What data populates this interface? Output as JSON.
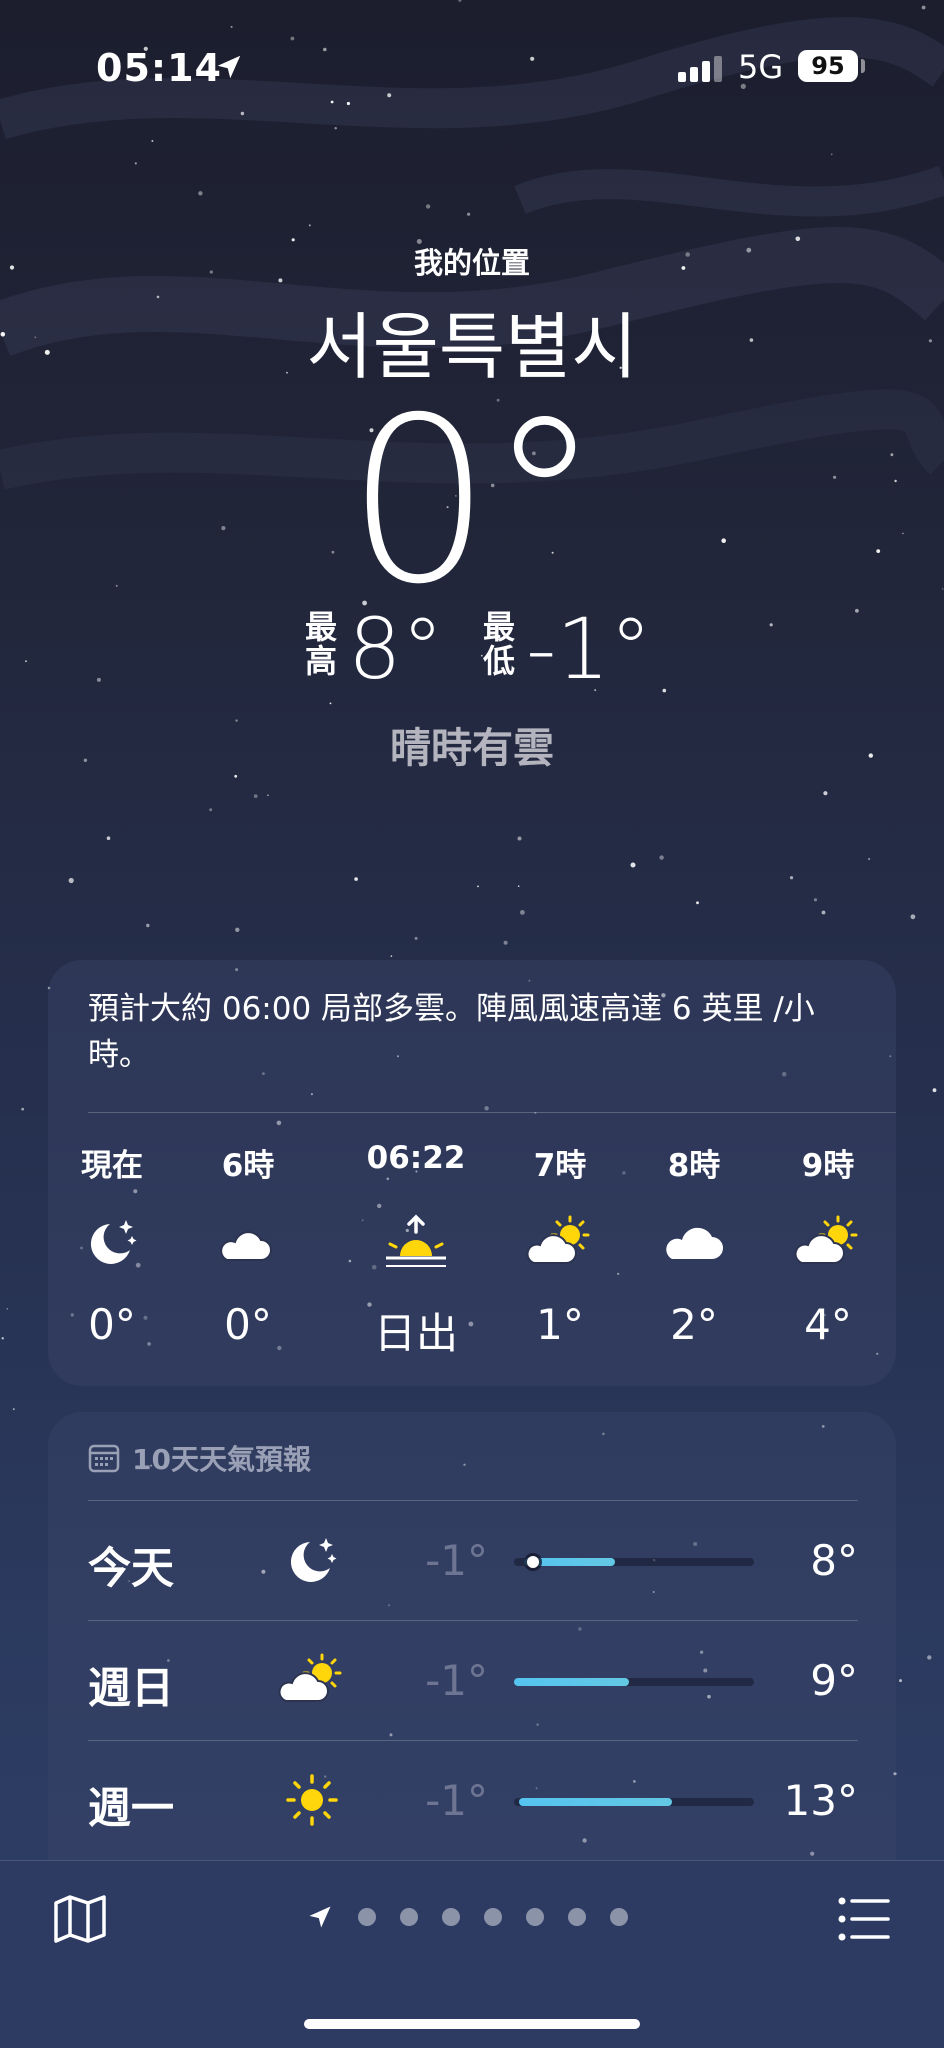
{
  "status_bar": {
    "time": "05:14",
    "network": "5G",
    "battery": "95",
    "icons": [
      "location-arrow-icon",
      "signal-bars-icon"
    ]
  },
  "header": {
    "my_location": "我的位置",
    "city": "서울특별시",
    "temperature": "0°",
    "high_label": "最高",
    "high": "8°",
    "low_label": "最低",
    "low": "-1°",
    "condition": "晴時有雲"
  },
  "hourly": {
    "summary": "預計大約 06:00 局部多雲。陣風風速高達 6 英里 /小時。",
    "items": [
      {
        "label": "現在",
        "icon": "moon-stars-icon",
        "temp": "0°"
      },
      {
        "label": "6時",
        "icon": "cloud-moon-icon",
        "temp": "0°"
      },
      {
        "label": "06:22",
        "icon": "sunrise-icon",
        "temp": "日出"
      },
      {
        "label": "7時",
        "icon": "cloud-sun-icon",
        "temp": "1°"
      },
      {
        "label": "8時",
        "icon": "cloud-icon",
        "temp": "2°"
      },
      {
        "label": "9時",
        "icon": "cloud-sun-icon",
        "temp": "4°"
      }
    ]
  },
  "ten_day": {
    "title": "10天天氣預報",
    "title_icon": "calendar-icon",
    "days": [
      {
        "name": "今天",
        "icon": "moon-stars-icon",
        "low": "-1°",
        "high": "8°",
        "range_start": 0.04,
        "range_end": 0.42,
        "current": 0.08
      },
      {
        "name": "週日",
        "icon": "cloud-sun-icon",
        "low": "-1°",
        "high": "9°",
        "range_start": 0.0,
        "range_end": 0.48
      },
      {
        "name": "週一",
        "icon": "sun-icon",
        "low": "-1°",
        "high": "13°",
        "range_start": 0.02,
        "range_end": 0.66
      }
    ]
  },
  "toolbar": {
    "map_icon": "map-icon",
    "list_icon": "list-icon",
    "pages": 7,
    "current_page_icon": "location-arrow-icon"
  },
  "colors": {
    "background_top": "#1c1e2e",
    "background_bottom": "#2f3e66",
    "range_bar": "#56c4f0",
    "sun": "#ffd60a",
    "condition_text": "#b3b4bd",
    "low_temp_text": "#6d7593"
  }
}
